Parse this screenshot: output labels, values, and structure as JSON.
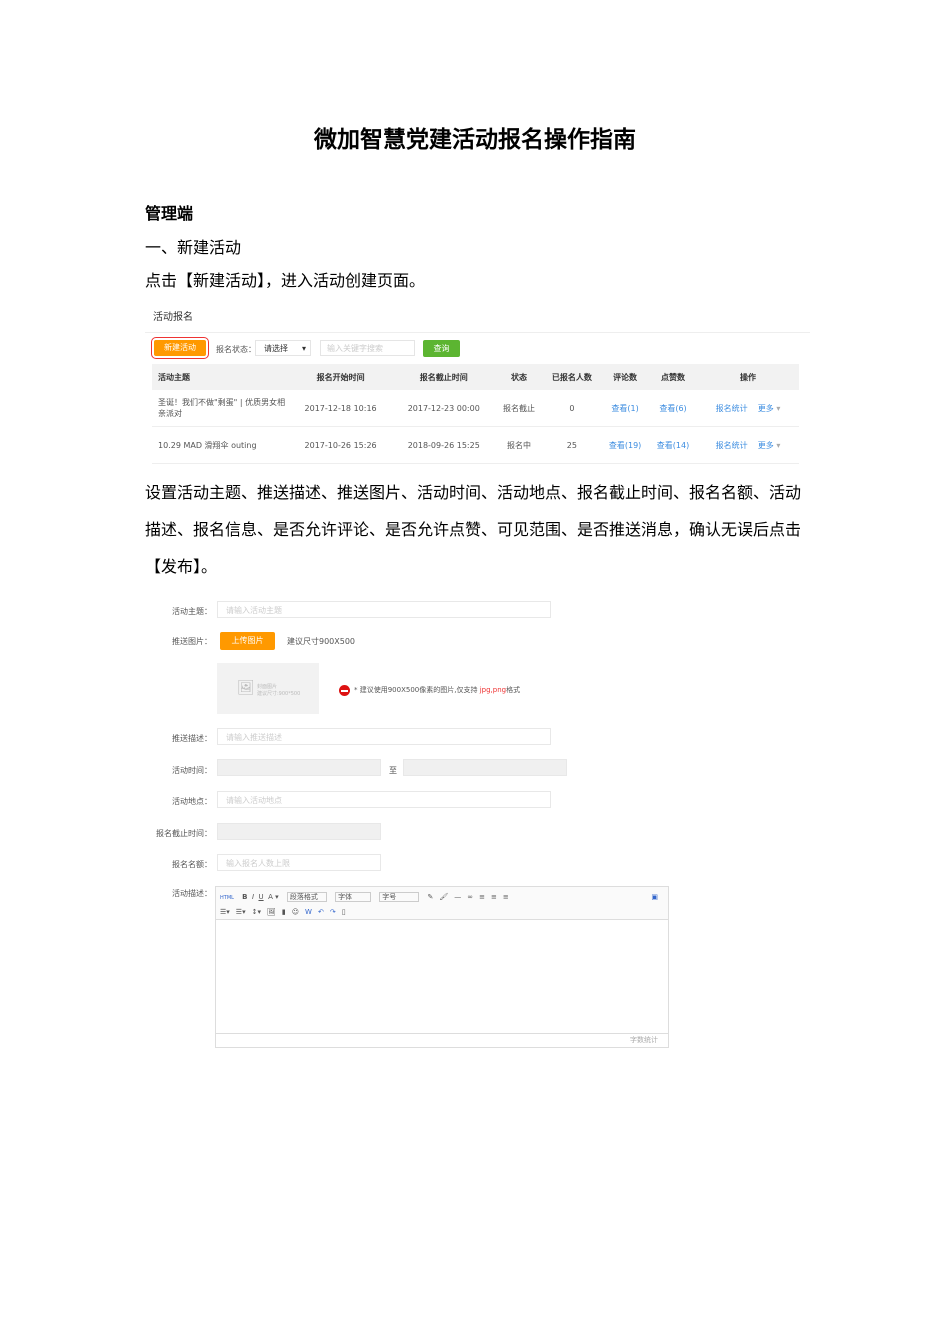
{
  "title": "微加智慧党建活动报名操作指南",
  "section": "管理端",
  "step1": "一、新建活动",
  "step1_desc": "点击【新建活动】，进入活动创建页面。",
  "list_shot": {
    "page_title": "活动报名",
    "new_button": "新建活动",
    "status_label": "报名状态：",
    "status_select": "请选择",
    "keyword_placeholder": "输入关键字搜索",
    "query_button": "查询",
    "columns": [
      "活动主题",
      "报名开始时间",
      "报名截止时间",
      "状态",
      "已报名人数",
      "评论数",
      "点赞数",
      "操作"
    ],
    "rows": [
      {
        "topic": "圣诞！我们不做\"剩蛋\" | 优质男女相亲派对",
        "start": "2017-12-18 10:16",
        "end": "2017-12-23 00:00",
        "status": "报名截止",
        "count": "0",
        "comments": "查看(1)",
        "likes": "查看(6)",
        "stats": "报名统计",
        "more": "更多"
      },
      {
        "topic": "10.29 MAD 滑翔伞 outing",
        "start": "2017-10-26 15:26",
        "end": "2018-09-26 15:25",
        "status": "报名中",
        "count": "25",
        "comments": "查看(19)",
        "likes": "查看(14)",
        "stats": "报名统计",
        "more": "更多"
      }
    ]
  },
  "step2_desc": "设置活动主题、推送描述、推送图片、活动时间、活动地点、报名截止时间、报名名额、活动描述、报名信息、是否允许评论、是否允许点赞、可见范围、是否推送消息，确认无误后点击【发布】。",
  "form_shot": {
    "topic_label": "活动主题：",
    "topic_placeholder": "请输入活动主题",
    "image_label": "推送图片：",
    "upload_button": "上传图片",
    "size_hint": "建议尺寸900X500",
    "cover_text": "封面图片",
    "cover_size": "建议尺寸:900*500",
    "warning_text": "* 建议使用900X500像素的图片,仅支持 ",
    "warning_formats": "jpg,png",
    "warning_suffix": "格式",
    "desc_label": "推送描述：",
    "desc_placeholder": "请输入推送描述",
    "time_label": "活动时间：",
    "time_to": "至",
    "place_label": "活动地点：",
    "place_placeholder": "请输入活动地点",
    "deadline_label": "报名截止时间：",
    "quota_label": "报名名额：",
    "quota_placeholder": "输入报名人数上限",
    "activity_desc_label": "活动描述：",
    "toolbar": {
      "html": "HTML",
      "bold": "B",
      "italic": "I",
      "underline": "U",
      "font_color": "A ▾",
      "para": "段落格式",
      "font": "字体",
      "size": "字号"
    },
    "word_count": "字数统计"
  }
}
